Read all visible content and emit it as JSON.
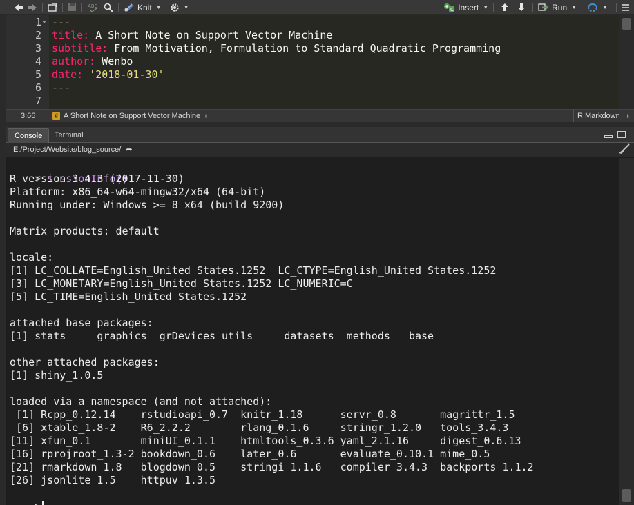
{
  "toolbar": {
    "knit_label": "Knit",
    "insert_label": "Insert",
    "run_label": "Run"
  },
  "editor": {
    "lines": [
      {
        "num": "1",
        "parts": [
          {
            "cls": "dash",
            "t": "---"
          }
        ]
      },
      {
        "num": "2",
        "parts": [
          {
            "cls": "k",
            "t": "title:"
          },
          {
            "cls": "w",
            "t": " A Short Note on Support Vector Machine"
          }
        ]
      },
      {
        "num": "3",
        "parts": [
          {
            "cls": "k",
            "t": "subtitle:"
          },
          {
            "cls": "w",
            "t": " From Motivation, Formulation to Standard Quadratic Programming"
          }
        ]
      },
      {
        "num": "4",
        "parts": [
          {
            "cls": "k",
            "t": "author:"
          },
          {
            "cls": "w",
            "t": " Wenbo"
          }
        ]
      },
      {
        "num": "5",
        "parts": [
          {
            "cls": "k",
            "t": "date:"
          },
          {
            "cls": "w",
            "t": " "
          },
          {
            "cls": "s",
            "t": "'2018-01-30'"
          }
        ]
      },
      {
        "num": "6",
        "parts": [
          {
            "cls": "dash",
            "t": "---"
          }
        ]
      },
      {
        "num": "7",
        "parts": []
      }
    ]
  },
  "status": {
    "position": "3:66",
    "outline": "A Short Note on Support Vector Machine",
    "outline_badge": "#",
    "doc_type": "R Markdown"
  },
  "console_pane": {
    "tabs": [
      {
        "label": "Console"
      },
      {
        "label": "Terminal"
      }
    ],
    "path": "E:/Project/Website/blog_source/"
  },
  "console": {
    "prompt": ">",
    "command": "sessionInfo()",
    "output": [
      "R version 3.4.3 (2017-11-30)",
      "Platform: x86_64-w64-mingw32/x64 (64-bit)",
      "Running under: Windows >= 8 x64 (build 9200)",
      "",
      "Matrix products: default",
      "",
      "locale:",
      "[1] LC_COLLATE=English_United States.1252  LC_CTYPE=English_United States.1252",
      "[3] LC_MONETARY=English_United States.1252 LC_NUMERIC=C",
      "[5] LC_TIME=English_United States.1252",
      "",
      "attached base packages:",
      "[1] stats     graphics  grDevices utils     datasets  methods   base",
      "",
      "other attached packages:",
      "[1] shiny_1.0.5",
      "",
      "loaded via a namespace (and not attached):",
      " [1] Rcpp_0.12.14    rstudioapi_0.7  knitr_1.18      servr_0.8       magrittr_1.5",
      " [6] xtable_1.8-2    R6_2.2.2        rlang_0.1.6     stringr_1.2.0   tools_3.4.3",
      "[11] xfun_0.1        miniUI_0.1.1    htmltools_0.3.6 yaml_2.1.16     digest_0.6.13",
      "[16] rprojroot_1.3-2 bookdown_0.6    later_0.6       evaluate_0.10.1 mime_0.5",
      "[21] rmarkdown_1.8   blogdown_0.5    stringi_1.1.6   compiler_3.4.3  backports_1.1.2",
      "[26] jsonlite_1.5    httpuv_1.3.5"
    ]
  }
}
